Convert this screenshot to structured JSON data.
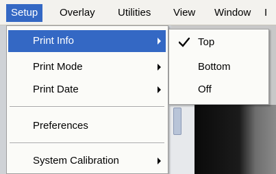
{
  "menubar": {
    "items": [
      {
        "label": "Setup"
      },
      {
        "label": "Overlay"
      },
      {
        "label": "Utilities"
      },
      {
        "label": "View"
      },
      {
        "label": "Window"
      },
      {
        "label": "I"
      }
    ]
  },
  "setup_menu": {
    "items": [
      {
        "label": "Print Info",
        "has_submenu": true,
        "highlighted": true
      },
      {
        "label": "Print Mode",
        "has_submenu": true
      },
      {
        "label": "Print Date",
        "has_submenu": true
      },
      {
        "label": "Preferences",
        "has_submenu": false
      },
      {
        "label": "System Calibration",
        "has_submenu": true
      }
    ]
  },
  "print_info_submenu": {
    "items": [
      {
        "label": "Top",
        "checked": true,
        "icon": "checkmark-icon"
      },
      {
        "label": "Bottom",
        "checked": false
      },
      {
        "label": "Off",
        "checked": false
      }
    ]
  },
  "colors": {
    "highlight": "#3468c4",
    "menu_bg": "#fbfbf8",
    "menubar_bg": "#f3f2ee"
  }
}
